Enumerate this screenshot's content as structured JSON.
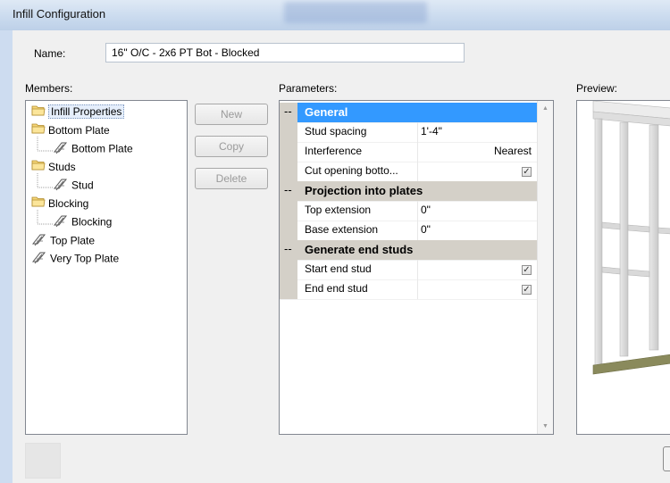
{
  "window": {
    "title": "Infill Configuration"
  },
  "name_field": {
    "label": "Name:",
    "value": "16\" O/C - 2x6 PT Bot - Blocked"
  },
  "members": {
    "label": "Members:",
    "items": [
      {
        "label": "Infill Properties",
        "icon": "folder-icon",
        "selected": true
      },
      {
        "label": "Bottom Plate",
        "icon": "folder-icon"
      },
      {
        "label": "Bottom Plate",
        "icon": "lumber-icon"
      },
      {
        "label": "Studs",
        "icon": "folder-icon"
      },
      {
        "label": "Stud",
        "icon": "lumber-icon"
      },
      {
        "label": "Blocking",
        "icon": "folder-icon"
      },
      {
        "label": "Blocking",
        "icon": "lumber-icon"
      },
      {
        "label": "Top Plate",
        "icon": "lumber-icon"
      },
      {
        "label": "Very Top Plate",
        "icon": "lumber-icon"
      }
    ]
  },
  "buttons": {
    "new": "New",
    "copy": "Copy",
    "delete": "Delete"
  },
  "parameters": {
    "label": "Parameters:",
    "rows": [
      {
        "type": "category",
        "label": "General",
        "toggle": "--"
      },
      {
        "type": "prop",
        "name": "Stud spacing",
        "value": "1'-4\""
      },
      {
        "type": "prop",
        "name": "Interference",
        "value": "Nearest"
      },
      {
        "type": "prop",
        "name": "Cut opening botto...",
        "checked": true
      },
      {
        "type": "category",
        "label": "Projection into plates",
        "toggle": "--"
      },
      {
        "type": "prop",
        "name": "Top extension",
        "value": "0\""
      },
      {
        "type": "prop",
        "name": "Base extension",
        "value": "0\""
      },
      {
        "type": "category",
        "label": "Generate end studs",
        "toggle": "--"
      },
      {
        "type": "prop",
        "name": "Start end stud",
        "checked": true
      },
      {
        "type": "prop",
        "name": "End end stud",
        "checked": true
      }
    ],
    "check_glyph": "✓"
  },
  "preview": {
    "label": "Preview:"
  },
  "colors": {
    "selection": "#3399ff",
    "category_bg": "#d4d0c8",
    "plate": "#8a8a5c"
  }
}
